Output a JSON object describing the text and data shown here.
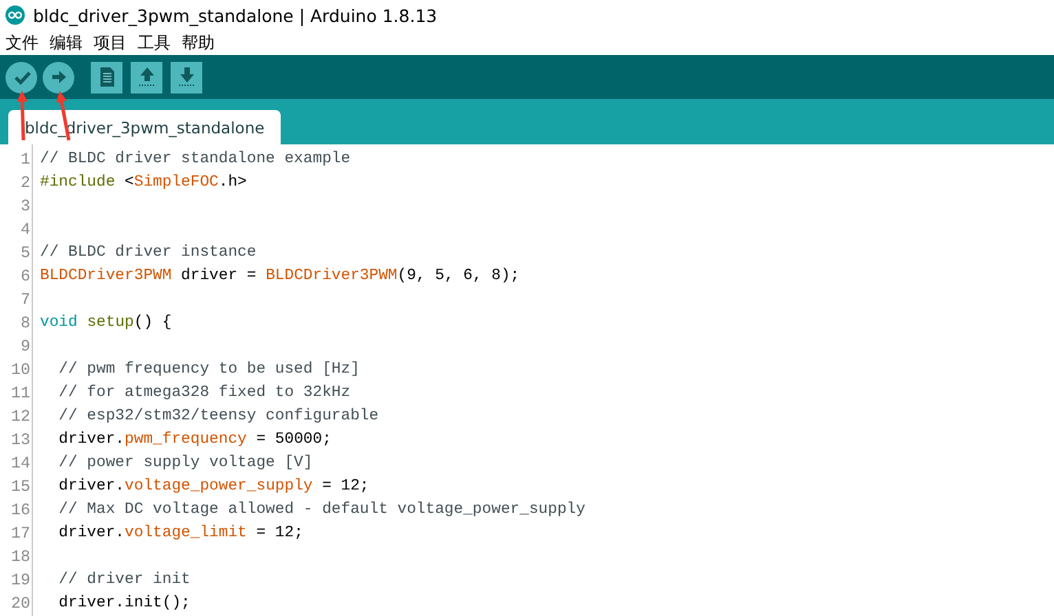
{
  "window": {
    "title": "bldc_driver_3pwm_standalone | Arduino 1.8.13"
  },
  "menu": [
    "文件",
    "编辑",
    "项目",
    "工具",
    "帮助"
  ],
  "toolbar": [
    {
      "kind": "verify"
    },
    {
      "kind": "upload"
    },
    {
      "kind": "new"
    },
    {
      "kind": "open"
    },
    {
      "kind": "save"
    }
  ],
  "tabs": [
    {
      "label": "bldc_driver_3pwm_standalone",
      "selected": true
    }
  ],
  "editor": {
    "lines": [
      {
        "number": "1",
        "tokens": [
          {
            "kind": "comment",
            "text": "// BLDC driver standalone example"
          }
        ]
      },
      {
        "number": "2",
        "tokens": [
          {
            "kind": "directive",
            "text": "#include"
          },
          {
            "kind": "plain",
            "text": " <"
          },
          {
            "kind": "type",
            "text": "SimpleFOC"
          },
          {
            "kind": "plain",
            "text": ".h>"
          }
        ]
      },
      {
        "number": "3"
      },
      {
        "number": "4"
      },
      {
        "number": "5",
        "tokens": [
          {
            "kind": "comment",
            "text": "// BLDC driver instance"
          }
        ]
      },
      {
        "number": "6",
        "tokens": [
          {
            "kind": "type",
            "text": "BLDCDriver3PWM"
          },
          {
            "kind": "plain",
            "text": " driver = "
          },
          {
            "kind": "type",
            "text": "BLDCDriver3PWM"
          },
          {
            "kind": "plain",
            "text": "(9, 5, 6, 8);"
          }
        ]
      },
      {
        "number": "7"
      },
      {
        "number": "8",
        "tokens": [
          {
            "kind": "keyword",
            "text": "void "
          },
          {
            "kind": "function",
            "text": "setup"
          },
          {
            "kind": "plain",
            "text": "() {"
          }
        ]
      },
      {
        "number": "9"
      },
      {
        "number": "10",
        "tokens": [
          {
            "kind": "comment",
            "text": "  // pwm frequency to be used [Hz]"
          }
        ]
      },
      {
        "number": "11",
        "tokens": [
          {
            "kind": "comment",
            "text": "  // for atmega328 fixed to 32kHz"
          }
        ]
      },
      {
        "number": "12",
        "tokens": [
          {
            "kind": "comment",
            "text": "  // esp32/stm32/teensy configurable"
          }
        ]
      },
      {
        "number": "13",
        "tokens": [
          {
            "kind": "plain",
            "text": "  driver."
          },
          {
            "kind": "type",
            "text": "pwm_frequency"
          },
          {
            "kind": "plain",
            "text": " = 50000;"
          }
        ]
      },
      {
        "number": "14",
        "tokens": [
          {
            "kind": "comment",
            "text": "  // power supply voltage [V]"
          }
        ]
      },
      {
        "number": "15",
        "tokens": [
          {
            "kind": "plain",
            "text": "  driver."
          },
          {
            "kind": "type",
            "text": "voltage_power_supply"
          },
          {
            "kind": "plain",
            "text": " = 12;"
          }
        ]
      },
      {
        "number": "16",
        "tokens": [
          {
            "kind": "comment",
            "text": "  // Max DC voltage allowed - default voltage_power_supply"
          }
        ]
      },
      {
        "number": "17",
        "tokens": [
          {
            "kind": "plain",
            "text": "  driver."
          },
          {
            "kind": "type",
            "text": "voltage_limit"
          },
          {
            "kind": "plain",
            "text": " = 12;"
          }
        ]
      },
      {
        "number": "18"
      },
      {
        "number": "19",
        "tokens": [
          {
            "kind": "comment",
            "text": "  // driver init"
          }
        ]
      },
      {
        "number": "20",
        "tokens": [
          {
            "kind": "plain",
            "text": "  driver.init();"
          }
        ]
      }
    ]
  }
}
